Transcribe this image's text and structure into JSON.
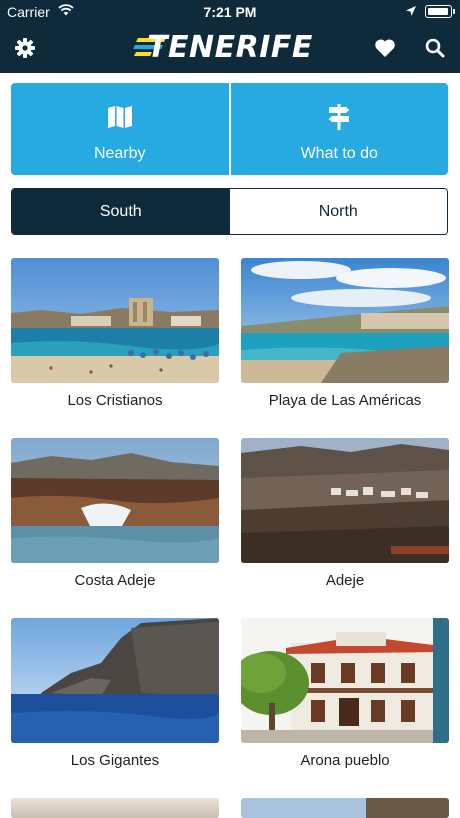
{
  "status_bar": {
    "carrier": "Carrier",
    "time": "7:21 PM"
  },
  "header": {
    "logo_text": "TENERIFE",
    "icons": [
      "gear-icon",
      "heart-icon",
      "search-icon"
    ]
  },
  "tiles": [
    {
      "label": "Nearby",
      "icon": "map-icon"
    },
    {
      "label": "What to do",
      "icon": "signpost-icon"
    }
  ],
  "segment": {
    "options": [
      "South",
      "North"
    ],
    "selected": "South"
  },
  "places": [
    {
      "name": "Los Cristianos"
    },
    {
      "name": "Playa de Las Américas"
    },
    {
      "name": "Costa Adeje"
    },
    {
      "name": "Adeje"
    },
    {
      "name": "Los Gigantes"
    },
    {
      "name": "Arona pueblo"
    }
  ],
  "colors": {
    "header_bg": "#0e2a3b",
    "tile_blue": "#27a9e1",
    "logo_yellow": "#f7e21b"
  }
}
